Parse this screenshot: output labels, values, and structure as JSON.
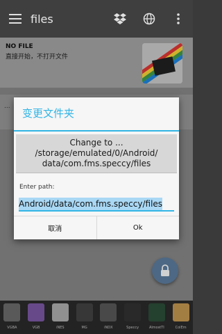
{
  "appbar": {
    "title": "files",
    "icons": [
      "menu-icon",
      "dropbox-icon",
      "globe-icon",
      "more-icon"
    ]
  },
  "file_card": {
    "title": "NO FILE",
    "subtitle": "直接开始，不打开文件"
  },
  "band2": {
    "text_fragment": "..."
  },
  "dialog": {
    "title": "变更文件夹",
    "message_line1": "Change to ...",
    "message_line2": "/storage/emulated/0/Android/",
    "message_line3": "data/com.fms.speccy/files",
    "field_label": "Enter path:",
    "field_value": "Android/data/com.fms.speccy/files",
    "cancel_label": "取消",
    "ok_label": "Ok"
  },
  "dock": {
    "items": [
      {
        "label": "VGBA",
        "color": "#6d6d6d"
      },
      {
        "label": "VGB",
        "color": "#7e5aa8"
      },
      {
        "label": "iNES",
        "color": "#b0b0b0"
      },
      {
        "label": "MG",
        "color": "#444444"
      },
      {
        "label": "iNDX",
        "color": "#5a5a5a"
      },
      {
        "label": "Speccy",
        "color": "#333333"
      },
      {
        "label": "AlmostTI",
        "color": "#2d4f3a"
      },
      {
        "label": "ColEm",
        "color": "#c79a52"
      }
    ]
  },
  "colors": {
    "accent": "#33b5e5",
    "fab": "#5f7fa2"
  }
}
